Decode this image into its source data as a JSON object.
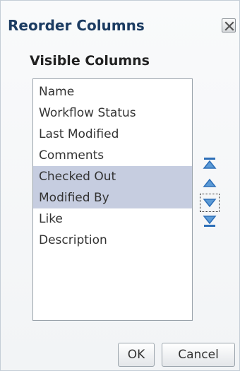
{
  "dialog": {
    "title": "Reorder Columns",
    "close_icon": "close-icon"
  },
  "visible_columns": {
    "label": "Visible Columns",
    "items": [
      {
        "label": "Name",
        "selected": false
      },
      {
        "label": "Workflow Status",
        "selected": false
      },
      {
        "label": "Last Modified",
        "selected": false
      },
      {
        "label": "Comments",
        "selected": false
      },
      {
        "label": "Checked Out",
        "selected": true
      },
      {
        "label": "Modified By",
        "selected": true
      },
      {
        "label": "Like",
        "selected": false
      },
      {
        "label": "Description",
        "selected": false
      }
    ]
  },
  "reorder_buttons": [
    {
      "name": "move-to-top",
      "icon": "move-to-top-icon"
    },
    {
      "name": "move-up",
      "icon": "move-up-icon"
    },
    {
      "name": "move-down",
      "icon": "move-down-icon",
      "focused": true
    },
    {
      "name": "move-to-bottom",
      "icon": "move-to-bottom-icon"
    }
  ],
  "footer": {
    "ok_label": "OK",
    "cancel_label": "Cancel"
  },
  "colors": {
    "title": "#1c3c62",
    "selection": "#c6cde0",
    "arrow": "#2d6fb8"
  }
}
